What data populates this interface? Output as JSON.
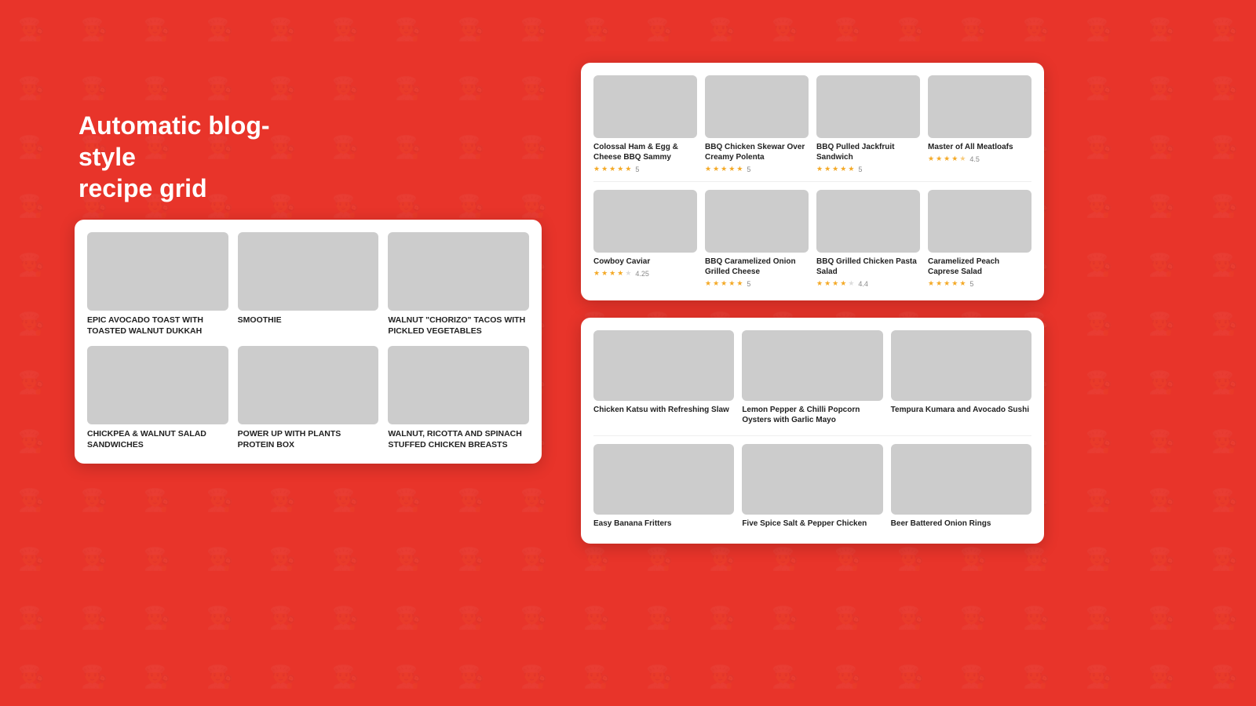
{
  "background": {
    "color": "#e8342a"
  },
  "headline": {
    "line1": "Automatic blog-style",
    "line2": "recipe grid"
  },
  "left_panel": {
    "recipes": [
      {
        "id": "avocado-toast",
        "title": "EPIC AVOCADO TOAST WITH TOASTED WALNUT DUKKAH",
        "color_class": "food-avocado"
      },
      {
        "id": "smoothie",
        "title": "SMOOTHIE",
        "color_class": "food-smoothie"
      },
      {
        "id": "walnut-tacos",
        "title": "WALNUT \"CHORIZO\" TACOS WITH PICKLED VEGETABLES",
        "color_class": "food-tacos"
      },
      {
        "id": "chickpea-walnut",
        "title": "CHICKPEA & WALNUT SALAD SANDWICHES",
        "color_class": "food-chickpea"
      },
      {
        "id": "power-up",
        "title": "POWER UP WITH PLANTS PROTEIN BOX",
        "color_class": "food-powerbox"
      },
      {
        "id": "stuffed-chicken",
        "title": "WALNUT, RICOTTA AND SPINACH STUFFED CHICKEN BREASTS",
        "color_class": "food-stuffed"
      }
    ]
  },
  "right_top_panel": {
    "row1": [
      {
        "id": "ham-egg",
        "title": "Colossal Ham & Egg & Cheese BBQ Sammy",
        "rating": 5,
        "rating_display": "5",
        "color_class": "food-ham"
      },
      {
        "id": "bbq-chicken-skewer",
        "title": "BBQ Chicken Skewar Over Creamy Polenta",
        "rating": 5,
        "rating_display": "5",
        "color_class": "food-bbqchicken"
      },
      {
        "id": "bbq-jackfruit",
        "title": "BBQ Pulled Jackfruit Sandwich",
        "rating": 5,
        "rating_display": "5",
        "color_class": "food-jackfruit"
      },
      {
        "id": "meatloaf",
        "title": "Master of All Meatloafs",
        "rating": 4.5,
        "rating_display": "4.5",
        "color_class": "food-meatloaf"
      }
    ],
    "row2": [
      {
        "id": "cowboy-caviar",
        "title": "Cowboy Caviar",
        "rating": 4.25,
        "rating_display": "4.25",
        "color_class": "food-cowboy"
      },
      {
        "id": "bbq-caramelized",
        "title": "BBQ Caramelized Onion Grilled Cheese",
        "rating": 5,
        "rating_display": "5",
        "color_class": "food-bbqcheese"
      },
      {
        "id": "bbq-grilled-pasta",
        "title": "BBQ Grilled Chicken Pasta Salad",
        "rating": 4.4,
        "rating_display": "4.4",
        "color_class": "food-bbqpasta"
      },
      {
        "id": "caprese",
        "title": "Caramelized Peach Caprese Salad",
        "rating": 5,
        "rating_display": "5",
        "color_class": "food-caprese"
      }
    ]
  },
  "right_bottom_panel": {
    "row1": [
      {
        "id": "chicken-katsu",
        "title": "Chicken Katsu with Refreshing Slaw",
        "color_class": "food-katsu"
      },
      {
        "id": "lemon-popcorn",
        "title": "Lemon Pepper & Chilli Popcorn Oysters with Garlic Mayo",
        "color_class": "food-popcorn"
      },
      {
        "id": "tempura-kumara",
        "title": "Tempura Kumara and Avocado Sushi",
        "color_class": "food-tempura"
      }
    ],
    "row2": [
      {
        "id": "banana-fritters",
        "title": "Easy Banana Fritters",
        "color_class": "food-banana"
      },
      {
        "id": "five-spice",
        "title": "Five Spice Salt & Pepper Chicken",
        "color_class": "food-fivespice"
      },
      {
        "id": "onion-rings",
        "title": "Beer Battered Onion Rings",
        "color_class": "food-onionrings"
      }
    ]
  },
  "stars": {
    "full": "★",
    "half": "★",
    "empty": "☆"
  }
}
